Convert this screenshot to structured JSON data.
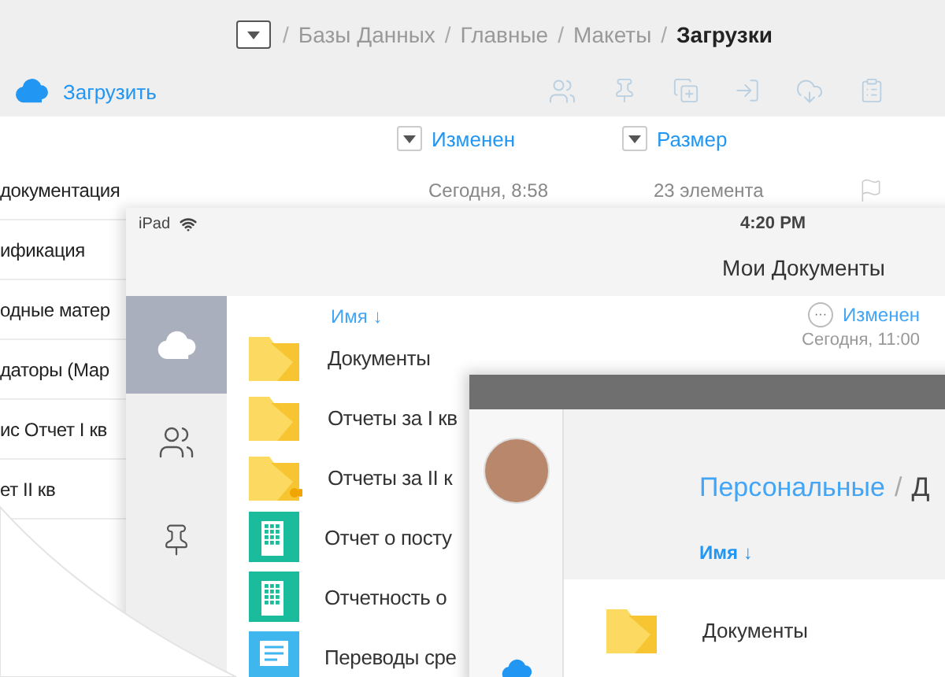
{
  "desktop": {
    "breadcrumb": {
      "separator": "/",
      "items": [
        {
          "label": "Базы Данных",
          "current": false
        },
        {
          "label": "Главные",
          "current": false
        },
        {
          "label": "Макеты",
          "current": false
        },
        {
          "label": "Загрузки",
          "current": true
        }
      ]
    },
    "upload_button": "Загрузить",
    "columns": [
      "Изменен",
      "Размер"
    ],
    "rows": [
      {
        "name": "документация",
        "modified": "Сегодня, 8:58",
        "size": "23 элемента",
        "flag": true
      },
      {
        "name": "ификация"
      },
      {
        "name": "одные матер"
      },
      {
        "name": "даторы (Мар"
      },
      {
        "name": "ис Отчет I кв"
      },
      {
        "name": "ет II кв"
      }
    ]
  },
  "ipad": {
    "status": {
      "device": "iPad",
      "time": "4:20 PM"
    },
    "title": "Мои Документы",
    "sidebar": [
      {
        "kind": "cloud",
        "selected": true
      },
      {
        "kind": "people",
        "selected": false
      },
      {
        "kind": "pin",
        "selected": false
      }
    ],
    "sort_label": "Имя ↓",
    "modified_column": "Изменен",
    "more_button": "···",
    "rows": [
      {
        "kind": "folder",
        "name": "Документы",
        "modified": "Сегодня, 11:00"
      },
      {
        "kind": "folder",
        "name": "Отчеты за I кв"
      },
      {
        "kind": "shared-folder",
        "name": "Отчеты за II к"
      },
      {
        "kind": "spreadsheet",
        "name": "Отчет о посту"
      },
      {
        "kind": "spreadsheet",
        "name": "Отчетность о"
      },
      {
        "kind": "document",
        "name": "Переводы сре"
      }
    ]
  },
  "phone": {
    "breadcrumb": {
      "separator": "/",
      "items": [
        {
          "label": "Персональные",
          "current": false
        },
        {
          "label": "Д",
          "current": true
        }
      ]
    },
    "sort_label": "Имя ↓",
    "rows": [
      {
        "kind": "folder",
        "name": "Документы"
      }
    ]
  }
}
